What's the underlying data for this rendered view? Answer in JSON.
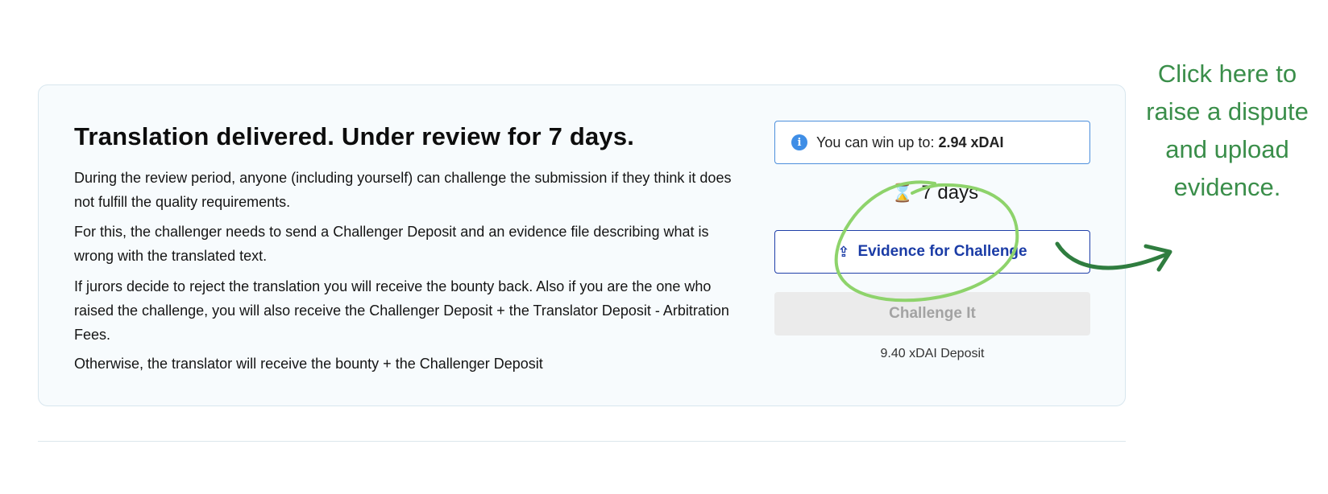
{
  "card": {
    "title": "Translation delivered. Under review for 7 days.",
    "paragraphs": [
      "During the review period, anyone (including yourself) can challenge the submission if they think it does not fulfill the quality requirements.",
      "For this, the challenger needs to send a Challenger Deposit and an evidence file describing what is wrong with the translated text.",
      "If jurors decide to reject the translation you will receive the bounty back. Also if you are the one who raised the challenge, you will also receive the Challenger Deposit + the Translator Deposit - Arbitration Fees.",
      "Otherwise, the translator will receive the bounty + the Challenger Deposit"
    ]
  },
  "sidebar": {
    "win_label": "You can win up to:",
    "win_amount": "2.94 xDAI",
    "timer": "7 days",
    "evidence_button": "Evidence for Challenge",
    "challenge_button": "Challenge It",
    "deposit": "9.40 xDAI Deposit"
  },
  "annotation": {
    "text": "Click here to raise a dispute and upload evidence."
  },
  "icons": {
    "info": "info-icon",
    "timer": "hourglass-icon",
    "upload": "upload-icon"
  },
  "colors": {
    "primary": "#1b3ca6",
    "info_border": "#4d8fdc",
    "annotation_green": "#3a8e4a",
    "circle_green": "#8ed36b"
  }
}
